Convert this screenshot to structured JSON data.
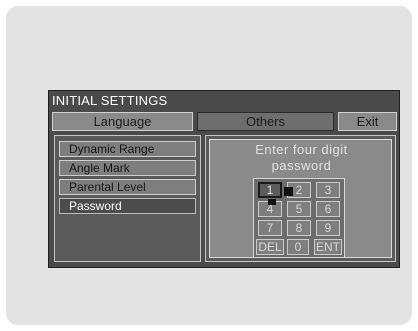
{
  "window": {
    "title": "INITIAL SETTINGS"
  },
  "tabs": [
    {
      "label": "Language"
    },
    {
      "label": "Others"
    },
    {
      "label": "Exit"
    }
  ],
  "menu": {
    "items": [
      {
        "label": "Dynamic Range"
      },
      {
        "label": "Angle Mark"
      },
      {
        "label": "Parental Level"
      },
      {
        "label": "Password"
      }
    ]
  },
  "password_panel": {
    "prompt_line1": "Enter four digit",
    "prompt_line2": "password"
  },
  "keypad": {
    "rows": [
      [
        "1",
        "2",
        "3"
      ],
      [
        "4",
        "5",
        "6"
      ],
      [
        "7",
        "8",
        "9"
      ],
      [
        "DEL",
        "0",
        "ENT"
      ]
    ]
  },
  "colors": {
    "osd_background": "#4a4a4a",
    "button": "#8a8a8a",
    "selected": "#4c4c4c",
    "text_light": "#e2e2e2"
  },
  "icons": {
    "cursor": "cursor-icon"
  }
}
